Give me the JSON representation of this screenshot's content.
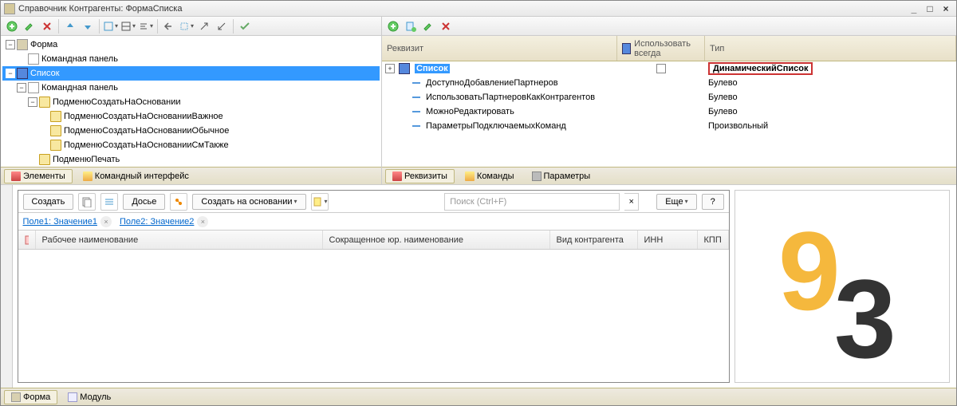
{
  "titlebar": "Справочник Контрагенты: ФормаСписка",
  "left_tree": [
    {
      "indent": 0,
      "toggle": "-",
      "icon": "form",
      "label": "Форма"
    },
    {
      "indent": 1,
      "toggle": "",
      "icon": "abc",
      "label": "Командная панель"
    },
    {
      "indent": 0,
      "toggle": "-",
      "icon": "grid",
      "label": "Список",
      "selected": true
    },
    {
      "indent": 1,
      "toggle": "-",
      "icon": "abc",
      "label": "Командная панель"
    },
    {
      "indent": 2,
      "toggle": "-",
      "icon": "folder",
      "label": "ПодменюСоздатьНаОсновании"
    },
    {
      "indent": 3,
      "toggle": "",
      "icon": "folder",
      "label": "ПодменюСоздатьНаОснованииВажное"
    },
    {
      "indent": 3,
      "toggle": "",
      "icon": "folder",
      "label": "ПодменюСоздатьНаОснованииОбычное"
    },
    {
      "indent": 3,
      "toggle": "",
      "icon": "folder",
      "label": "ПодменюСоздатьНаОснованииСмТакже"
    },
    {
      "indent": 2,
      "toggle": "",
      "icon": "folder",
      "label": "ПодменюПечать"
    }
  ],
  "left_tabs": {
    "elements": "Элементы",
    "ci": "Командный интерфейс"
  },
  "grid_headers": {
    "prop": "Реквизит",
    "use": "Использовать всегда",
    "type": "Тип"
  },
  "grid_rows": [
    {
      "indent": 0,
      "toggle": "+",
      "icon": "grid",
      "name": "Список",
      "use": "checkbox",
      "type": "ДинамическийСписок",
      "bold": true,
      "selected": true,
      "highlight_type": true
    },
    {
      "indent": 1,
      "toggle": "",
      "icon": "prop",
      "name": "ДоступноДобавлениеПартнеров",
      "type": "Булево"
    },
    {
      "indent": 1,
      "toggle": "",
      "icon": "prop",
      "name": "ИспользоватьПартнеровКакКонтрагентов",
      "type": "Булево"
    },
    {
      "indent": 1,
      "toggle": "",
      "icon": "prop",
      "name": "МожноРедактировать",
      "type": "Булево"
    },
    {
      "indent": 1,
      "toggle": "",
      "icon": "prop",
      "name": "ПараметрыПодключаемыхКоманд",
      "type": "Произвольный"
    }
  ],
  "right_tabs": {
    "r": "Реквизиты",
    "c": "Команды",
    "p": "Параметры"
  },
  "preview": {
    "toolbar": {
      "create": "Создать",
      "dossier": "Досье",
      "create_based": "Создать на основании",
      "search_placeholder": "Поиск (Ctrl+F)",
      "more": "Еще",
      "help": "?"
    },
    "filters": [
      {
        "label": "Поле1: Значение1"
      },
      {
        "label": "Поле2: Значение2"
      }
    ],
    "columns": {
      "c1": "Рабочее наименование",
      "c2": "Сокращенное юр. наименование",
      "c3": "Вид контрагента",
      "c4": "ИНН",
      "c5": "КПП"
    }
  },
  "form_tabs": {
    "form": "Форма",
    "module": "Модуль"
  }
}
